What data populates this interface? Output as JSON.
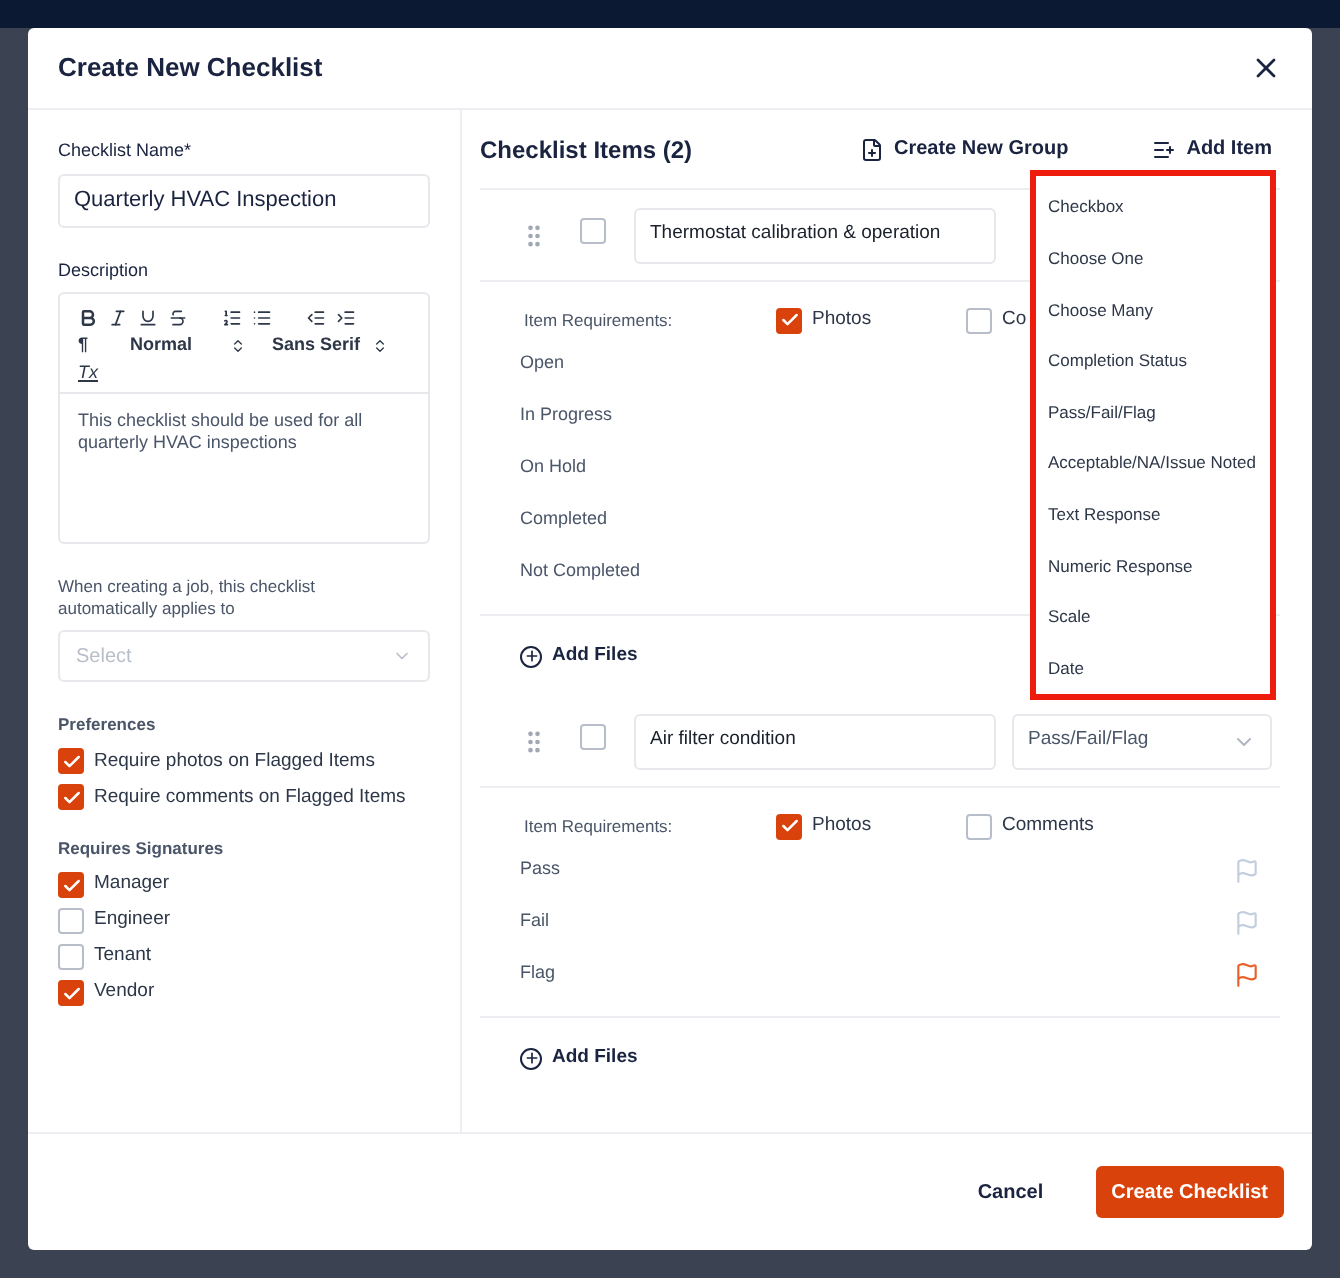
{
  "dialog": {
    "title": "Create New Checklist"
  },
  "form": {
    "name_label": "Checklist Name*",
    "name_value": "Quarterly HVAC Inspection",
    "description_label": "Description",
    "toolbar": {
      "format": "Normal",
      "font": "Sans Serif",
      "clear_icon": "Tx",
      "para_icon": "¶"
    },
    "description_value": "This checklist should be used for all quarterly HVAC inspections",
    "applies_label": "When creating a job, this checklist automatically applies to",
    "applies_placeholder": "Select"
  },
  "preferences": {
    "title": "Preferences",
    "items": [
      {
        "label": "Require photos on Flagged Items",
        "checked": true
      },
      {
        "label": "Require comments on Flagged Items",
        "checked": true
      }
    ]
  },
  "signatures": {
    "title": "Requires Signatures",
    "items": [
      {
        "label": "Manager",
        "checked": true
      },
      {
        "label": "Engineer",
        "checked": false
      },
      {
        "label": "Tenant",
        "checked": false
      },
      {
        "label": "Vendor",
        "checked": true
      }
    ]
  },
  "checklist": {
    "title": "Checklist Items (2)",
    "create_group": "Create New Group",
    "add_item": "Add Item",
    "items": [
      {
        "name": "Thermostat calibration & operation",
        "checked": false,
        "requirements_label": "Item Requirements:",
        "photos": {
          "label": "Photos",
          "checked": true
        },
        "comments": {
          "label": "Co",
          "checked": false
        },
        "statuses": [
          {
            "label": "Open"
          },
          {
            "label": "In Progress"
          },
          {
            "label": "On Hold"
          },
          {
            "label": "Completed"
          },
          {
            "label": "Not Completed"
          }
        ],
        "add_files": "Add Files"
      },
      {
        "name": "Air filter condition",
        "type": "Pass/Fail/Flag",
        "checked": false,
        "requirements_label": "Item Requirements:",
        "photos": {
          "label": "Photos",
          "checked": true
        },
        "comments": {
          "label": "Comments",
          "checked": false
        },
        "statuses": [
          {
            "label": "Pass",
            "flagged": false
          },
          {
            "label": "Fail",
            "flagged": false
          },
          {
            "label": "Flag",
            "flagged": true
          }
        ],
        "add_files": "Add Files"
      }
    ]
  },
  "type_menu": {
    "options": [
      "Checkbox",
      "Choose One",
      "Choose Many",
      "Completion Status",
      "Pass/Fail/Flag",
      "Acceptable/NA/Issue Noted",
      "Text Response",
      "Numeric Response",
      "Scale",
      "Date"
    ]
  },
  "footer": {
    "cancel": "Cancel",
    "submit": "Create Checklist"
  }
}
